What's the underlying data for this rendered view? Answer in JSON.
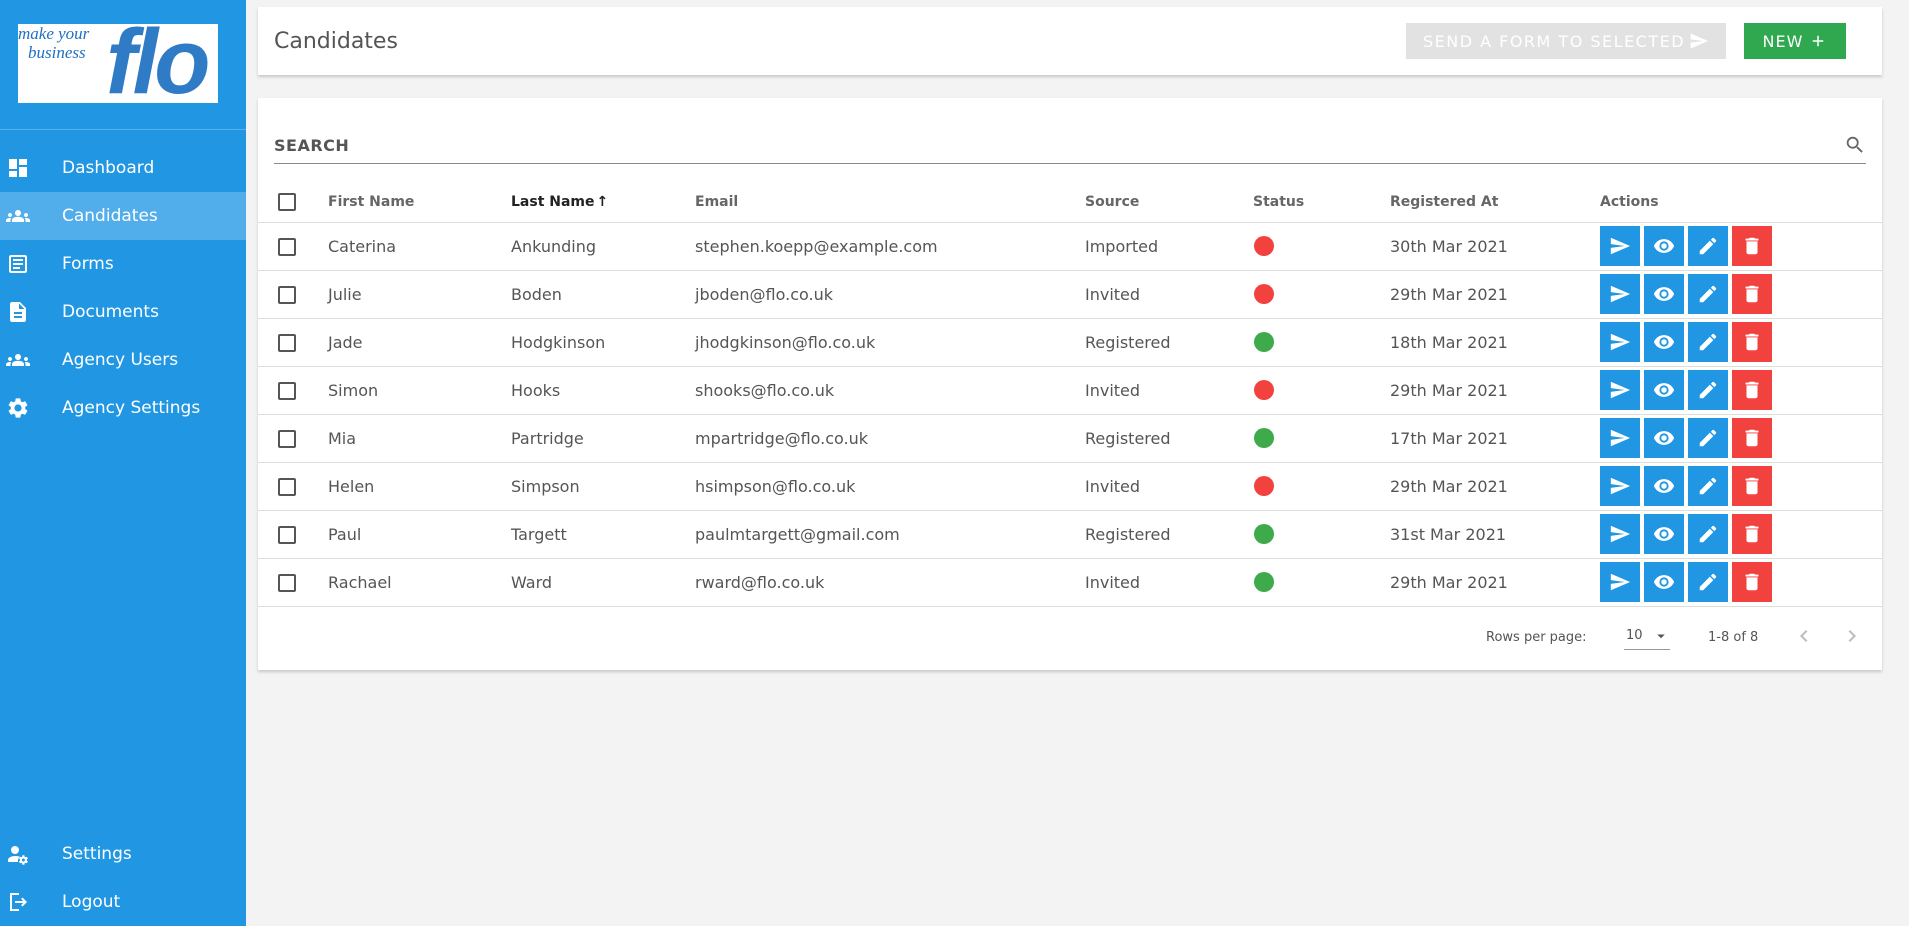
{
  "brand": {
    "tagline_line1": "make your",
    "tagline_line2": "business",
    "wordmark": "flo"
  },
  "sidebar": {
    "items": [
      {
        "label": "Dashboard",
        "icon": "dashboard-icon",
        "active": false
      },
      {
        "label": "Candidates",
        "icon": "people-icon",
        "active": true
      },
      {
        "label": "Forms",
        "icon": "forms-icon",
        "active": false
      },
      {
        "label": "Documents",
        "icon": "document-icon",
        "active": false
      },
      {
        "label": "Agency Users",
        "icon": "people-icon",
        "active": false
      },
      {
        "label": "Agency Settings",
        "icon": "gear-icon",
        "active": false
      }
    ],
    "bottom_items": [
      {
        "label": "Settings",
        "icon": "user-settings-icon"
      },
      {
        "label": "Logout",
        "icon": "logout-icon"
      }
    ]
  },
  "header": {
    "title": "Candidates",
    "send_label": "SEND A FORM TO SELECTED",
    "new_label": "NEW"
  },
  "search": {
    "placeholder": "SEARCH"
  },
  "table": {
    "columns": [
      "First Name",
      "Last Name",
      "Email",
      "Source",
      "Status",
      "Registered At",
      "Actions"
    ],
    "sort_arrow": "↑",
    "rows": [
      {
        "first": "Caterina",
        "last": "Ankunding",
        "email": "stephen.koepp@example.com",
        "source": "Imported",
        "status": "red",
        "registered": "30th Mar 2021"
      },
      {
        "first": "Julie",
        "last": "Boden",
        "email": "jboden@flo.co.uk",
        "source": "Invited",
        "status": "red",
        "registered": "29th Mar 2021"
      },
      {
        "first": "Jade",
        "last": "Hodgkinson",
        "email": "jhodgkinson@flo.co.uk",
        "source": "Registered",
        "status": "green",
        "registered": "18th Mar 2021"
      },
      {
        "first": "Simon",
        "last": "Hooks",
        "email": "shooks@flo.co.uk",
        "source": "Invited",
        "status": "red",
        "registered": "29th Mar 2021"
      },
      {
        "first": "Mia",
        "last": "Partridge",
        "email": "mpartridge@flo.co.uk",
        "source": "Registered",
        "status": "green",
        "registered": "17th Mar 2021"
      },
      {
        "first": "Helen",
        "last": "Simpson",
        "email": "hsimpson@flo.co.uk",
        "source": "Invited",
        "status": "red",
        "registered": "29th Mar 2021"
      },
      {
        "first": "Paul",
        "last": "Targett",
        "email": "paulmtargett@gmail.com",
        "source": "Registered",
        "status": "green",
        "registered": "31st Mar 2021"
      },
      {
        "first": "Rachael",
        "last": "Ward",
        "email": "rward@flo.co.uk",
        "source": "Invited",
        "status": "green",
        "registered": "29th Mar 2021"
      }
    ]
  },
  "pagination": {
    "rows_per_page_label": "Rows per page:",
    "rows_per_page": "10",
    "range": "1-8 of 8"
  },
  "colors": {
    "primary": "#2196e3",
    "success": "#2fa84f",
    "danger": "#f2423f",
    "status_red": "#f2423f",
    "status_green": "#3eaa4a"
  }
}
